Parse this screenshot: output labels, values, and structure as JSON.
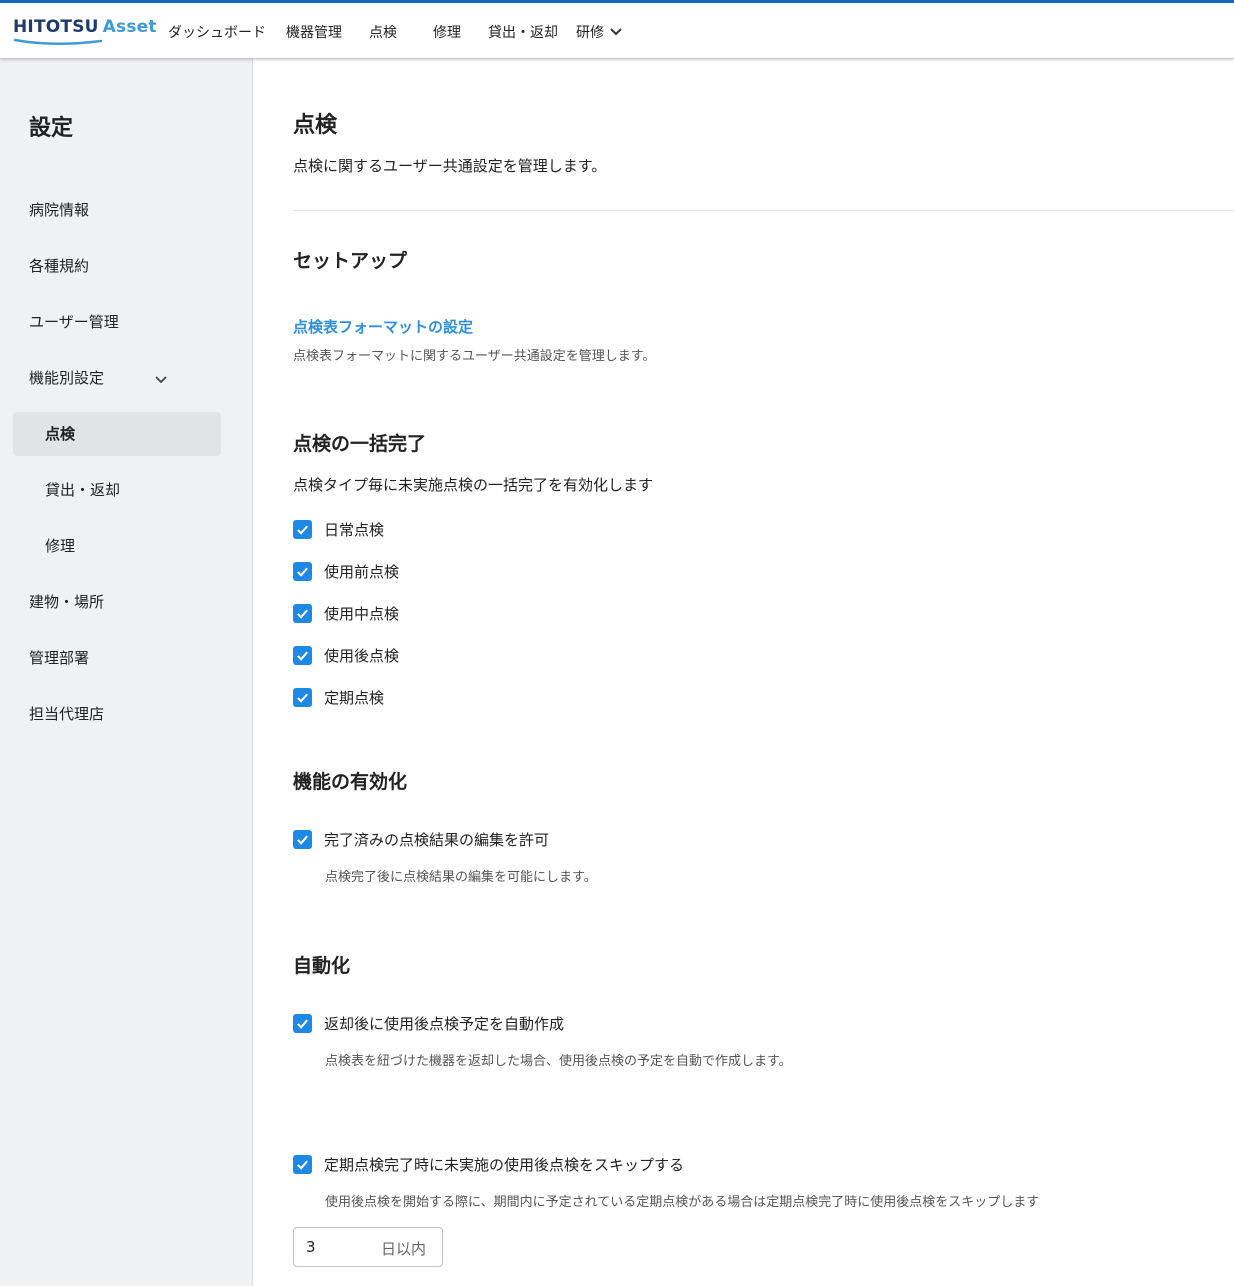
{
  "header": {
    "logo_main": "HITOTSU",
    "logo_sub": "Asset",
    "nav": [
      {
        "label": "ダッシュボード"
      },
      {
        "label": "機器管理"
      },
      {
        "label": "点検"
      },
      {
        "label": "修理"
      },
      {
        "label": "貸出・返却"
      },
      {
        "label": "研修"
      }
    ]
  },
  "sidebar": {
    "title": "設定",
    "items": [
      {
        "label": "病院情報"
      },
      {
        "label": "各種規約"
      },
      {
        "label": "ユーザー管理"
      },
      {
        "label": "機能別設定"
      },
      {
        "label": "点検"
      },
      {
        "label": "貸出・返却"
      },
      {
        "label": "修理"
      },
      {
        "label": "建物・場所"
      },
      {
        "label": "管理部署"
      },
      {
        "label": "担当代理店"
      }
    ]
  },
  "main": {
    "title": "点検",
    "description": "点検に関するユーザー共通設定を管理します。",
    "setup": {
      "heading": "セットアップ",
      "link": "点検表フォーマットの設定",
      "link_desc": "点検表フォーマットに関するユーザー共通設定を管理します。"
    },
    "bulk": {
      "heading": "点検の一括完了",
      "desc": "点検タイプ毎に未実施点検の一括完了を有効化します",
      "options": [
        {
          "label": "日常点検",
          "checked": true
        },
        {
          "label": "使用前点検",
          "checked": true
        },
        {
          "label": "使用中点検",
          "checked": true
        },
        {
          "label": "使用後点検",
          "checked": true
        },
        {
          "label": "定期点検",
          "checked": true
        }
      ]
    },
    "enable": {
      "heading": "機能の有効化",
      "option": {
        "label": "完了済みの点検結果の編集を許可",
        "checked": true
      },
      "option_desc": "点検完了後に点検結果の編集を可能にします。"
    },
    "auto": {
      "heading": "自動化",
      "option1": {
        "label": "返却後に使用後点検予定を自動作成",
        "checked": true
      },
      "option1_desc": "点検表を紐づけた機器を返却した場合、使用後点検の予定を自動で作成します。",
      "option2": {
        "label": "定期点検完了時に未実施の使用後点検をスキップする",
        "checked": true
      },
      "option2_desc": "使用後点検を開始する際に、期間内に予定されている定期点検がある場合は定期点検完了時に使用後点検をスキップします",
      "days_value": "3",
      "days_suffix": "日以内"
    }
  },
  "colors": {
    "accent": "#1565c0",
    "checkbox": "#1e88e5",
    "link": "#2e8fdc",
    "sidebar_bg": "#f0f1f4"
  },
  "icons": {
    "nav_dropdown": "chevron-down-icon",
    "sidebar_expand": "chevron-down-icon",
    "checkbox": "checkmark-icon"
  }
}
